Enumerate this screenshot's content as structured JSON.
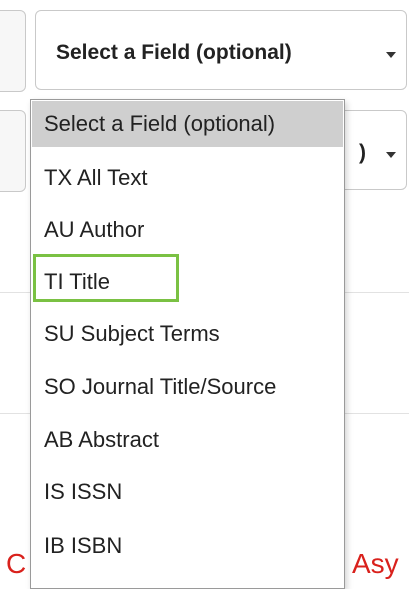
{
  "field_select_1": {
    "label": "Select a Field (optional)"
  },
  "field_select_2": {
    "label_visible_fragment": ")"
  },
  "dropdown": {
    "options": [
      {
        "label": "Select a Field (optional)"
      },
      {
        "label": "TX All Text"
      },
      {
        "label": "AU Author"
      },
      {
        "label": "TI Title"
      },
      {
        "label": "SU Subject Terms"
      },
      {
        "label": "SO Journal Title/Source"
      },
      {
        "label": "AB Abstract"
      },
      {
        "label": "IS ISSN"
      },
      {
        "label": "IB ISBN"
      }
    ],
    "highlighted_option": "TI Title"
  },
  "background_text": {
    "left_fragment": "C",
    "right_fragment": "Asy"
  },
  "colors": {
    "highlight": "#7ac143",
    "selected_option_bg": "#cfcfcf",
    "background_text": "#d9211c"
  }
}
